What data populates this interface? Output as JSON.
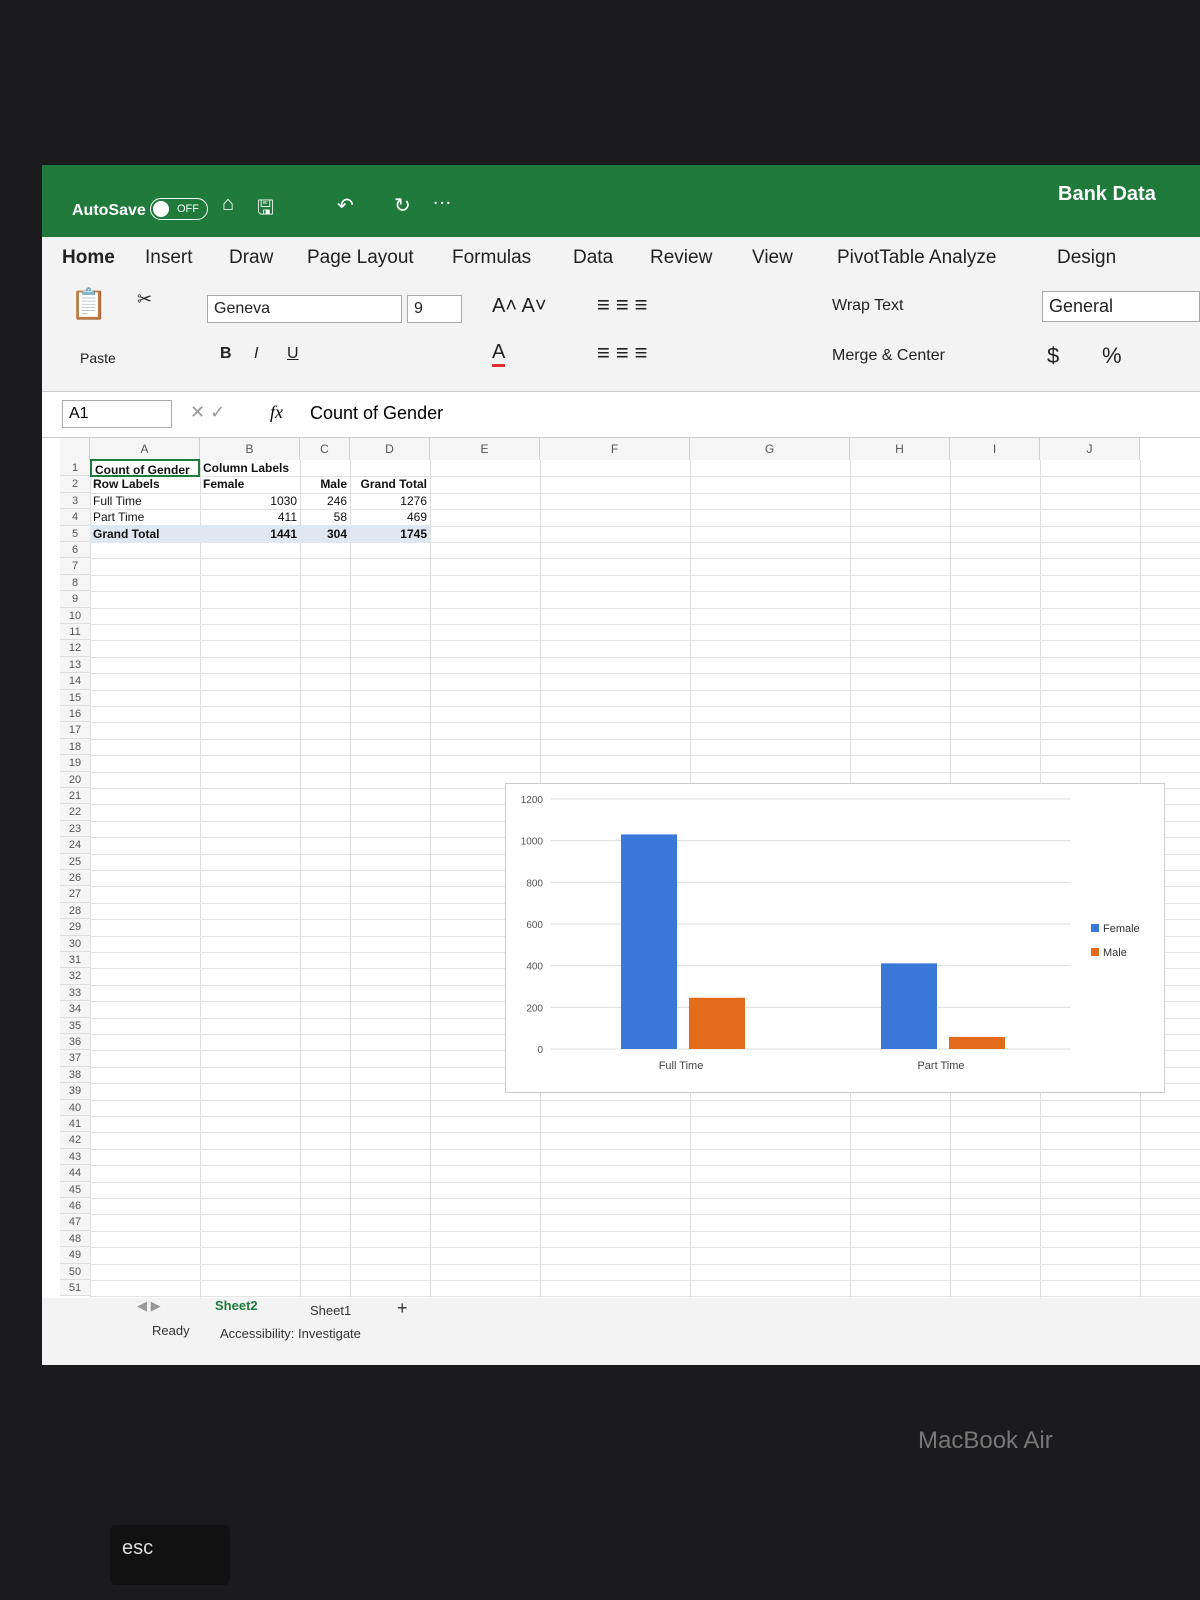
{
  "app": {
    "autosave_label": "AutoSave",
    "autosave_state": "OFF",
    "document_title": "Bank Data"
  },
  "tabs": [
    "Home",
    "Insert",
    "Draw",
    "Page Layout",
    "Formulas",
    "Data",
    "Review",
    "View",
    "PivotTable Analyze",
    "Design"
  ],
  "ribbon": {
    "paste": "Paste",
    "font": "Geneva",
    "font_size": "9",
    "bold": "B",
    "italic": "I",
    "underline": "U",
    "wrap_text": "Wrap Text",
    "merge_center": "Merge & Center",
    "number_format": "General",
    "currency": "$",
    "percent": "%"
  },
  "formula_bar": {
    "name_box": "A1",
    "fx": "fx",
    "content": "Count of Gender"
  },
  "columns": [
    "A",
    "B",
    "C",
    "D",
    "E",
    "F",
    "G",
    "H",
    "I",
    "J"
  ],
  "pivot": {
    "r1": [
      "Count of Gender",
      "Column Labels"
    ],
    "r2": [
      "Row Labels",
      "Female",
      "Male",
      "Grand Total"
    ],
    "rows": [
      [
        "Full Time",
        "1030",
        "246",
        "1276"
      ],
      [
        "Part Time",
        "411",
        "58",
        "469"
      ],
      [
        "Grand Total",
        "1441",
        "304",
        "1745"
      ]
    ]
  },
  "chart_data": {
    "type": "bar",
    "categories": [
      "Full Time",
      "Part Time"
    ],
    "series": [
      {
        "name": "Female",
        "values": [
          1030,
          411
        ],
        "color": "#3a78d8"
      },
      {
        "name": "Male",
        "values": [
          246,
          58
        ],
        "color": "#e36c1c"
      }
    ],
    "ylim": [
      0,
      1200
    ],
    "yticks": [
      "0",
      "200",
      "400",
      "600",
      "800",
      "1000",
      "1200"
    ],
    "legend": "right",
    "grid": true
  },
  "sheets": [
    "Sheet2",
    "Sheet1"
  ],
  "add_sheet": "+",
  "status": {
    "ready": "Ready",
    "accessibility": "Accessibility: Investigate"
  },
  "device": {
    "brand": "MacBook Air",
    "key_esc": "esc"
  }
}
